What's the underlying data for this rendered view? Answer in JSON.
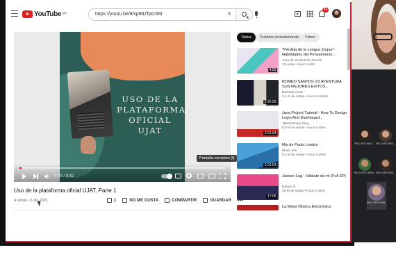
{
  "header": {
    "logo_text": "YouTube",
    "logo_sup": "MX",
    "search_value": "https://youtu.be/8NptMZfpGSM",
    "notification_count": "9+"
  },
  "player": {
    "thumbnail_title": "USO DE LA PLATAFORMA OFICIAL UJAT",
    "time_display": "0:00 / 0:42",
    "tooltip": "Pantalla completa (f)",
    "progress": 0.0
  },
  "video": {
    "title": "Uso de la plataforma oficial UJAT. Parte 1",
    "meta": "4 vistas • 6 dic 2021",
    "like_count": "1",
    "dislike_label": "NO ME GUSTA",
    "share_label": "COMPARTIR",
    "save_label": "GUARDAR",
    "more": "•••"
  },
  "chips": [
    "Todos",
    "Subidos recientemente",
    "Vistos"
  ],
  "related": [
    {
      "title": "\"Pérdida de la Lengua Zoque\"- Habilidades del Pensamiento...",
      "channel": "Sara de Jesús Díaz Ruedo",
      "views": "13 vistas • hace 1 año",
      "duration": "4:55"
    },
    {
      "title": "ROMEO SANTOS VS AVENTURA SUS MEJORES EXITOS...",
      "channel": "Bachata Amor",
      "views": "2.1 M de vistas • hace 6 meses",
      "duration": "2:26:58"
    },
    {
      "title": "Java Project Tutorial - How To Design Login And Dashboard...",
      "channel": "1BestCsharp blog",
      "views": "6.9 M de vistas • hace 5 años",
      "duration": "2:01:04"
    },
    {
      "title": "Mix de Paulo Londra",
      "channel": "Music Mix",
      "views": "5.4 M de vistas • hace 3 años",
      "duration": "1:01:03"
    },
    {
      "title": "Jósean Log - Háblate de mí (Full EP)",
      "channel": "Naturs ⊙",
      "views": "25 M de vistas • hace 4 años",
      "duration": "17:05"
    },
    {
      "title": "La Mejor Música Electrónica",
      "channel": "",
      "views": "",
      "duration": ""
    }
  ],
  "meet": {
    "participants": [
      {
        "name": "RELOYES MACI..."
      },
      {
        "name": "RELOYES SRD..."
      },
      {
        "name": "RELOYES CRIPA..."
      },
      {
        "name": "RELOYES RUE..."
      },
      {
        "name": "RELOYES SARA..."
      }
    ]
  },
  "colors": {
    "yt_red": "#e02020",
    "chip_active": "#111111",
    "meet_bg": "#202124",
    "frame_accent": "#cc2233"
  }
}
